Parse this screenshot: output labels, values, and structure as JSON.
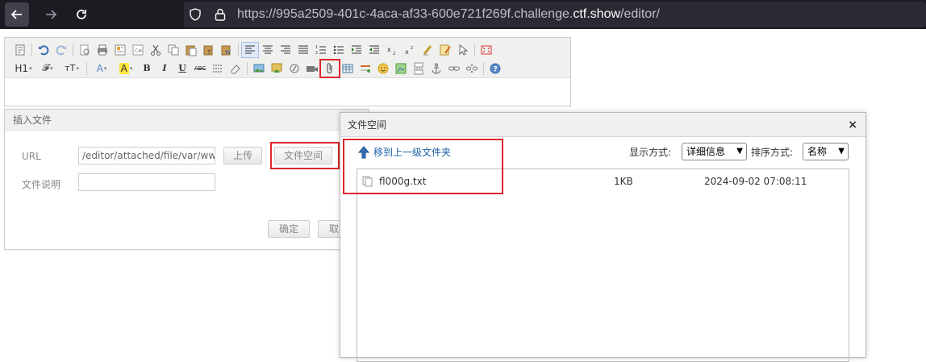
{
  "browser": {
    "url_prefix": "https://995a2509-401c-4aca-af33-600e721f269f.challenge.",
    "url_host": "ctf.show",
    "url_path": "/editor/"
  },
  "editor": {
    "toolbar_row2": {
      "heading": "H1",
      "font_family_icon": "𝓕",
      "font_size_icon": "тT",
      "bold": "B",
      "italic": "I",
      "underline": "U",
      "strike": "ABC"
    }
  },
  "insert_file_dialog": {
    "title": "插入文件",
    "url_label": "URL",
    "url_value": "/editor/attached/file/var/www/html/",
    "upload_button": "上传",
    "file_space_button": "文件空间",
    "desc_label": "文件说明",
    "desc_value": "",
    "confirm_button": "确定",
    "cancel_button": "取消"
  },
  "file_space_dialog": {
    "title": "文件空间",
    "close": "×",
    "up_one_level": "移到上一级文件夹",
    "view_label": "显示方式:",
    "view_value": "详细信息",
    "sort_label": "排序方式:",
    "sort_value": "名称",
    "files": [
      {
        "name": "fl000g.txt",
        "size": "1KB",
        "date": "2024-09-02 07:08:11"
      }
    ]
  },
  "colors": {
    "highlight_red": "#e0262d",
    "link_blue": "#1d5ea8",
    "browser_bg": "#1c1b22"
  }
}
